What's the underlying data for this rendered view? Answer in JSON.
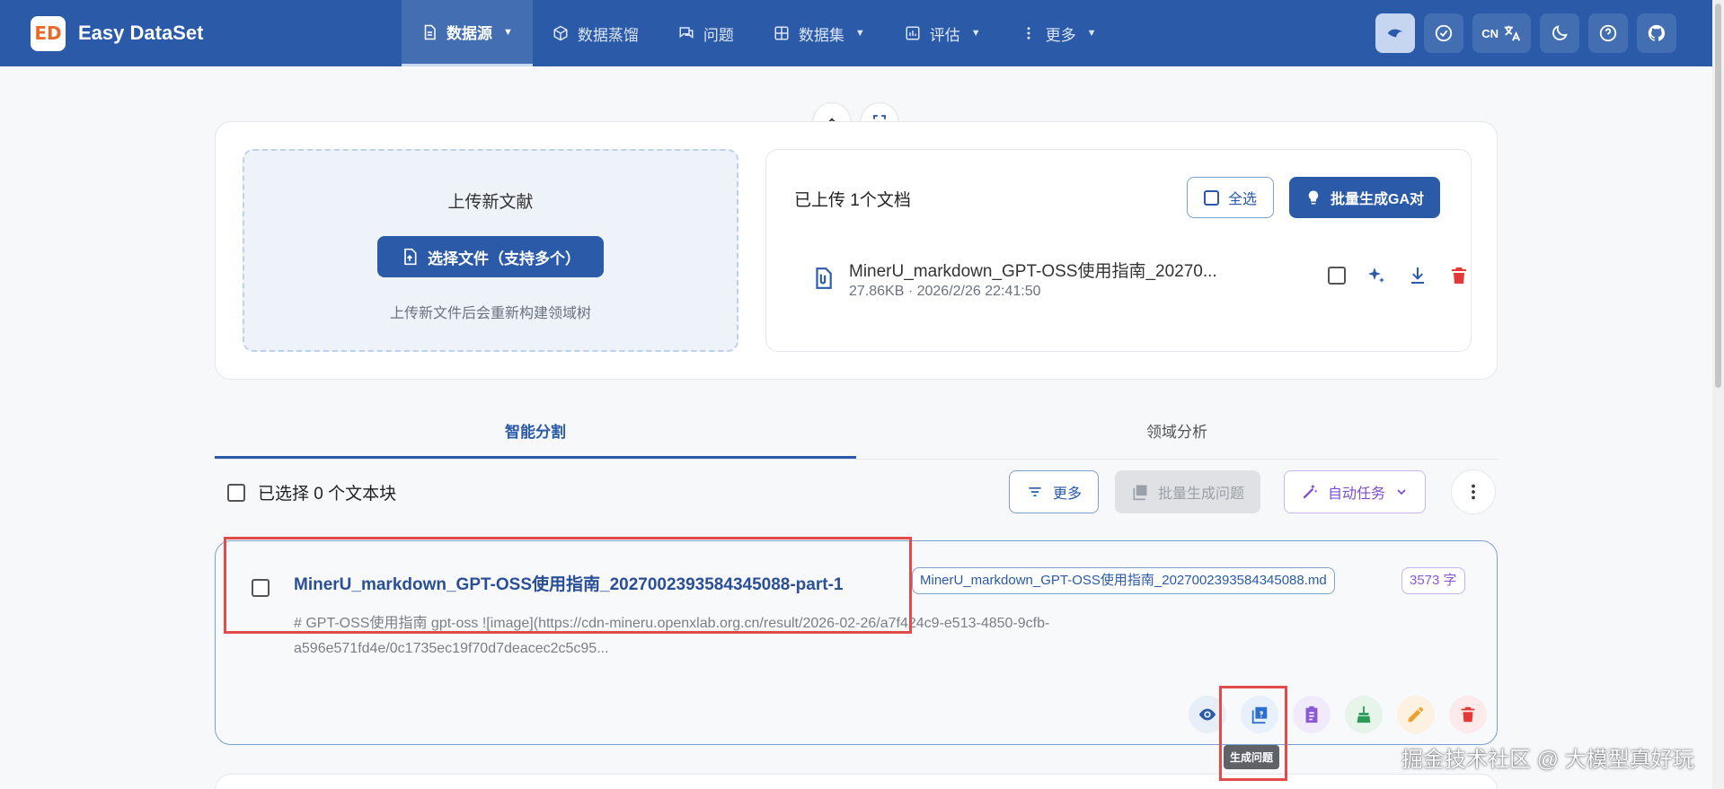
{
  "app": {
    "name": "Easy DataSet",
    "logo_text": "ED"
  },
  "nav": {
    "items": [
      {
        "label": "数据源",
        "icon": "document-icon",
        "dropdown": true,
        "active": true
      },
      {
        "label": "数据蒸馏",
        "icon": "cube-icon",
        "dropdown": false
      },
      {
        "label": "问题",
        "icon": "chat-icon",
        "dropdown": false
      },
      {
        "label": "数据集",
        "icon": "grid-icon",
        "dropdown": true
      },
      {
        "label": "评估",
        "icon": "chart-icon",
        "dropdown": true
      },
      {
        "label": "更多",
        "icon": "dots-vertical-icon",
        "dropdown": true
      }
    ],
    "lang_label": "CN"
  },
  "upload": {
    "title": "上传新文献",
    "button_label": "选择文件（支持多个）",
    "hint": "上传新文件后会重新构建领域树"
  },
  "files": {
    "title": "已上传 1个文档",
    "select_all_label": "全选",
    "batch_label": "批量生成GA对",
    "items": [
      {
        "name": "MinerU_markdown_GPT-OSS使用指南_20270...",
        "meta": "27.86KB · 2026/2/26 22:41:50"
      }
    ]
  },
  "tabs": [
    {
      "label": "智能分割",
      "active": true
    },
    {
      "label": "领域分析",
      "active": false
    }
  ],
  "toolbar": {
    "selected_text": "已选择 0 个文本块",
    "more_label": "更多",
    "batch_questions_label": "批量生成问题",
    "auto_task_label": "自动任务"
  },
  "chunk": {
    "title": "MinerU_markdown_GPT-OSS使用指南_2027002393584345088-part-1",
    "file_tag": "MinerU_markdown_GPT-OSS使用指南_2027002393584345088.md",
    "char_tag": "3573 字",
    "preview": "# GPT-OSS使用指南 gpt-oss ![image](https://cdn-mineru.openxlab.org.cn/result/2026-02-26/a7f424c9-e513-4850-9cfb-a596e571fd4e/0c1735ec19f70d7deacec2c5c95...",
    "tooltip": "生成问题"
  },
  "watermark": "掘金技术社区 @ 大模型真好玩",
  "colors": {
    "primary": "#2a5aa8",
    "highlight": "#e34a4a",
    "danger": "#e53935",
    "purple": "#8a5ad6"
  }
}
